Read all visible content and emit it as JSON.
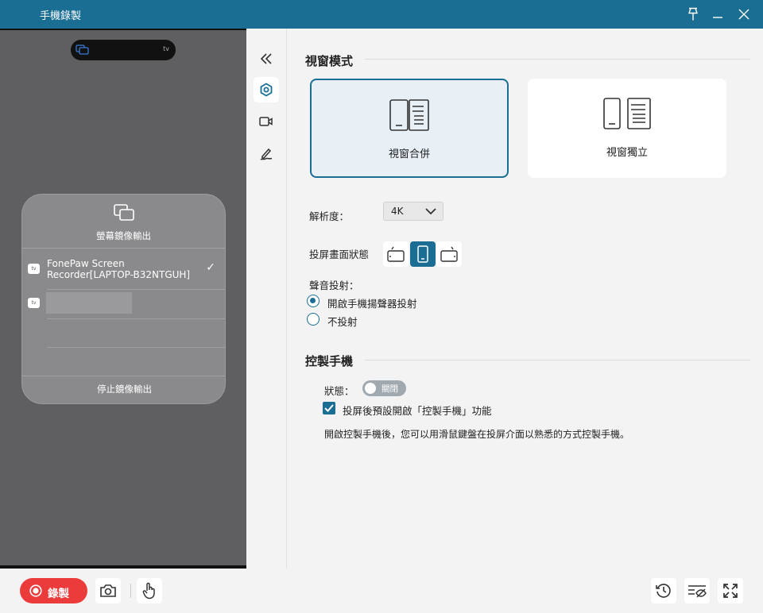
{
  "window": {
    "title": "手機錄製"
  },
  "phone": {
    "island_badge": "tv",
    "mirror_panel": {
      "title": "螢幕鏡像輸出",
      "device_name_line1": "FonePaw Screen",
      "device_name_line2": "Recorder[LAPTOP-B32NTGUH]",
      "device_badge": "tv",
      "stop_label": "停止鏡像輸出"
    }
  },
  "settings": {
    "window_mode": {
      "title": "視窗模式",
      "options": [
        {
          "label": "視窗合併",
          "selected": true
        },
        {
          "label": "視窗獨立",
          "selected": false
        }
      ]
    },
    "resolution": {
      "label": "解析度：",
      "value": "4K"
    },
    "orientation": {
      "label": "投屏畫面狀態"
    },
    "audio": {
      "label": "聲音投射：",
      "options": [
        {
          "label": "開啟手機揚聲器投射",
          "checked": true
        },
        {
          "label": "不投射",
          "checked": false
        }
      ]
    },
    "control": {
      "title": "控製手機",
      "status_label": "狀態：",
      "toggle_text": "關閉",
      "checkbox_label": "投屏後預設開啟「控製手機」功能",
      "description": "開啟控製手機後，您可以用滑鼠鍵盤在投屏介面以熟悉的方式控製手機。"
    }
  },
  "bottom": {
    "record_label": "錄製"
  },
  "colors": {
    "accent": "#1a6e93",
    "record": "#ec3b3b",
    "phone_bg": "#5f5f61"
  }
}
